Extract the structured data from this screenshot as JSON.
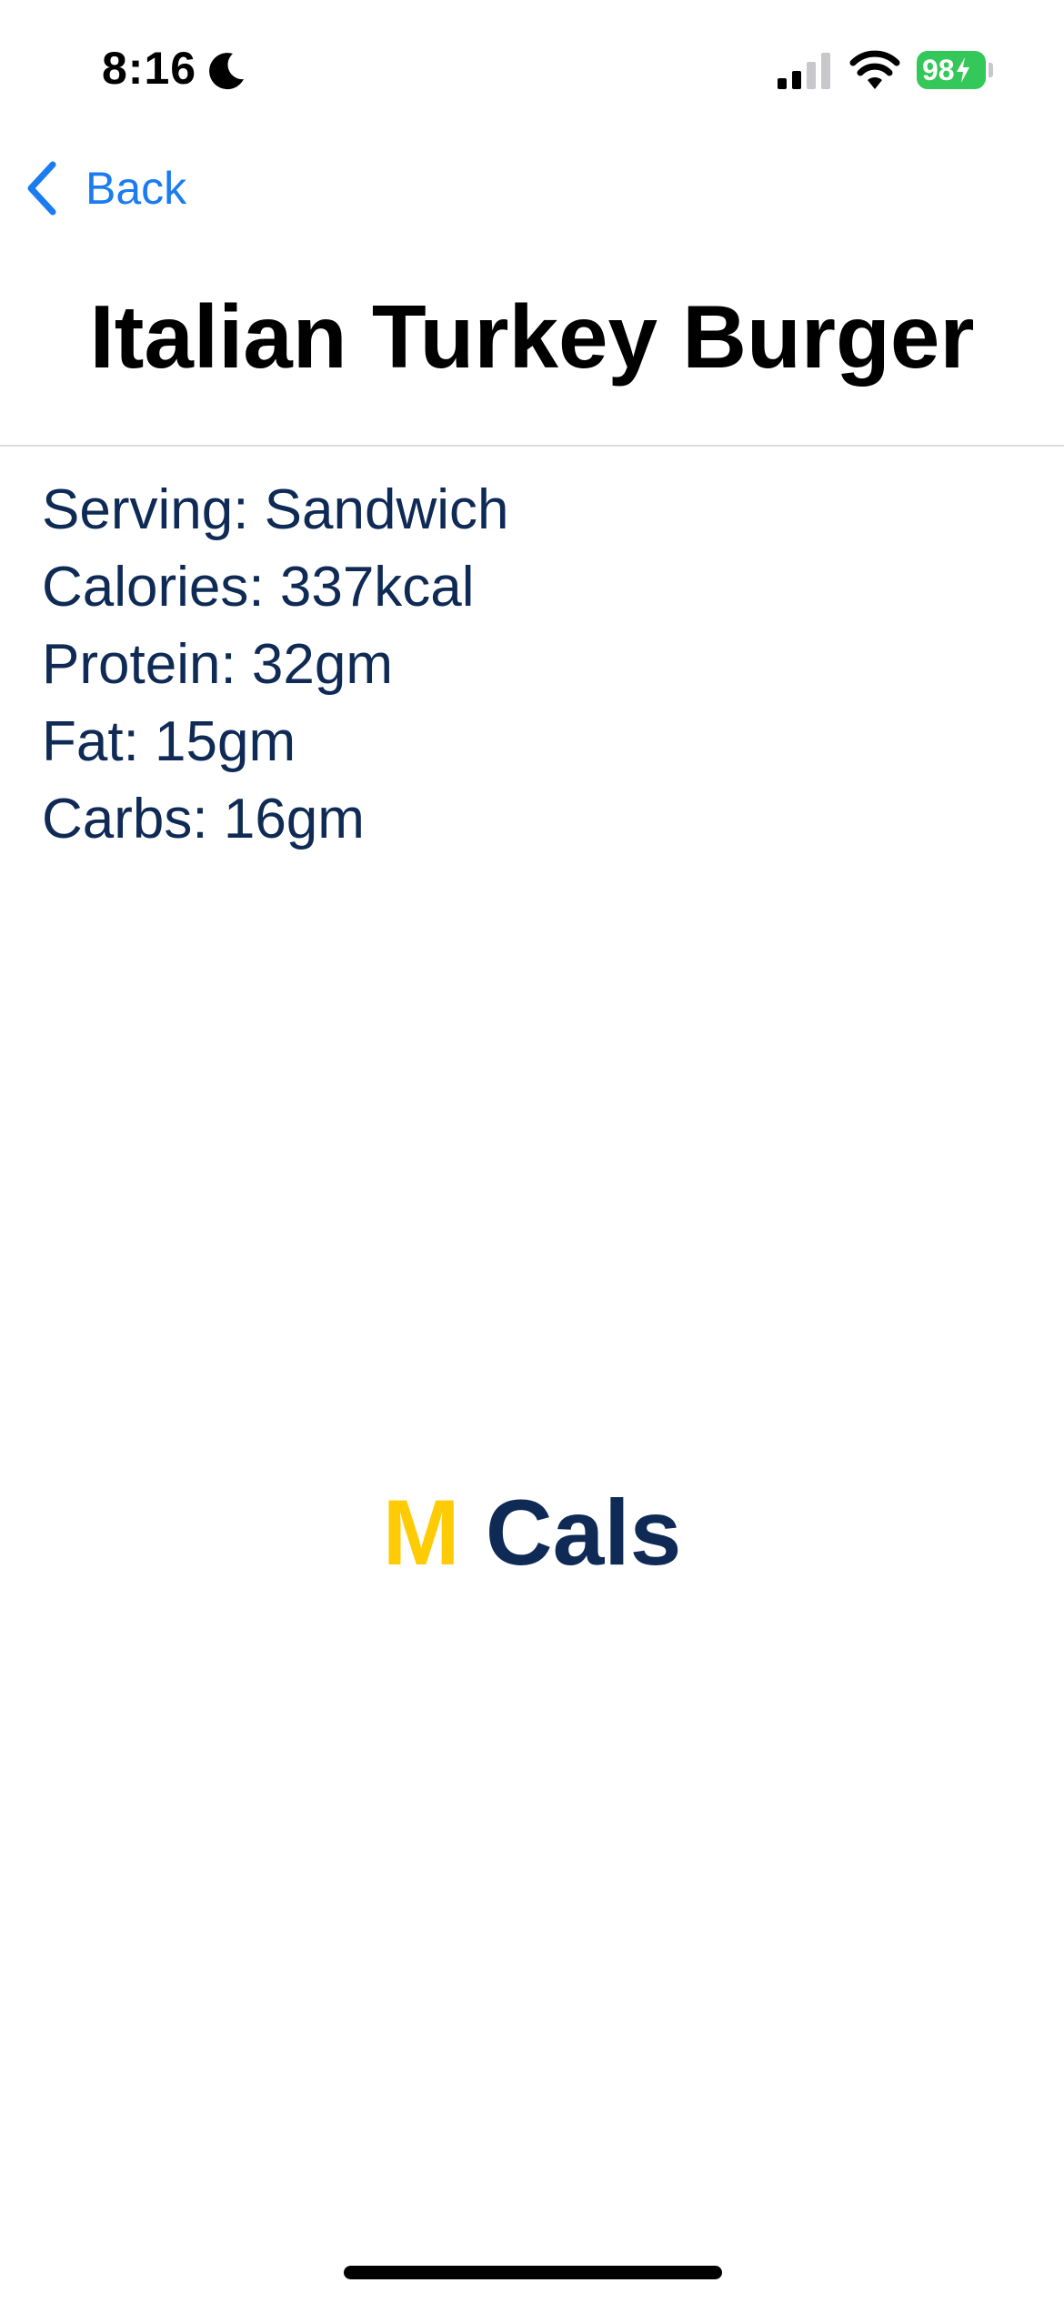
{
  "status_bar": {
    "time": "8:16",
    "battery_level": "98",
    "icons": [
      "moon-icon",
      "signal-icon",
      "wifi-icon",
      "battery-icon"
    ]
  },
  "nav": {
    "back_label": "Back"
  },
  "title": "Italian Turkey Burger",
  "nutrition": [
    "Serving: Sandwich",
    "Calories: 337kcal",
    "Protein: 32gm",
    "Fat: 15gm",
    "Carbs: 16gm"
  ],
  "brand": {
    "m": "M",
    "cals": "Cals"
  },
  "colors": {
    "accent_blue": "#1a7cf0",
    "navy": "#0e2a55",
    "maize": "#ffcb05",
    "battery_green": "#34c759"
  }
}
